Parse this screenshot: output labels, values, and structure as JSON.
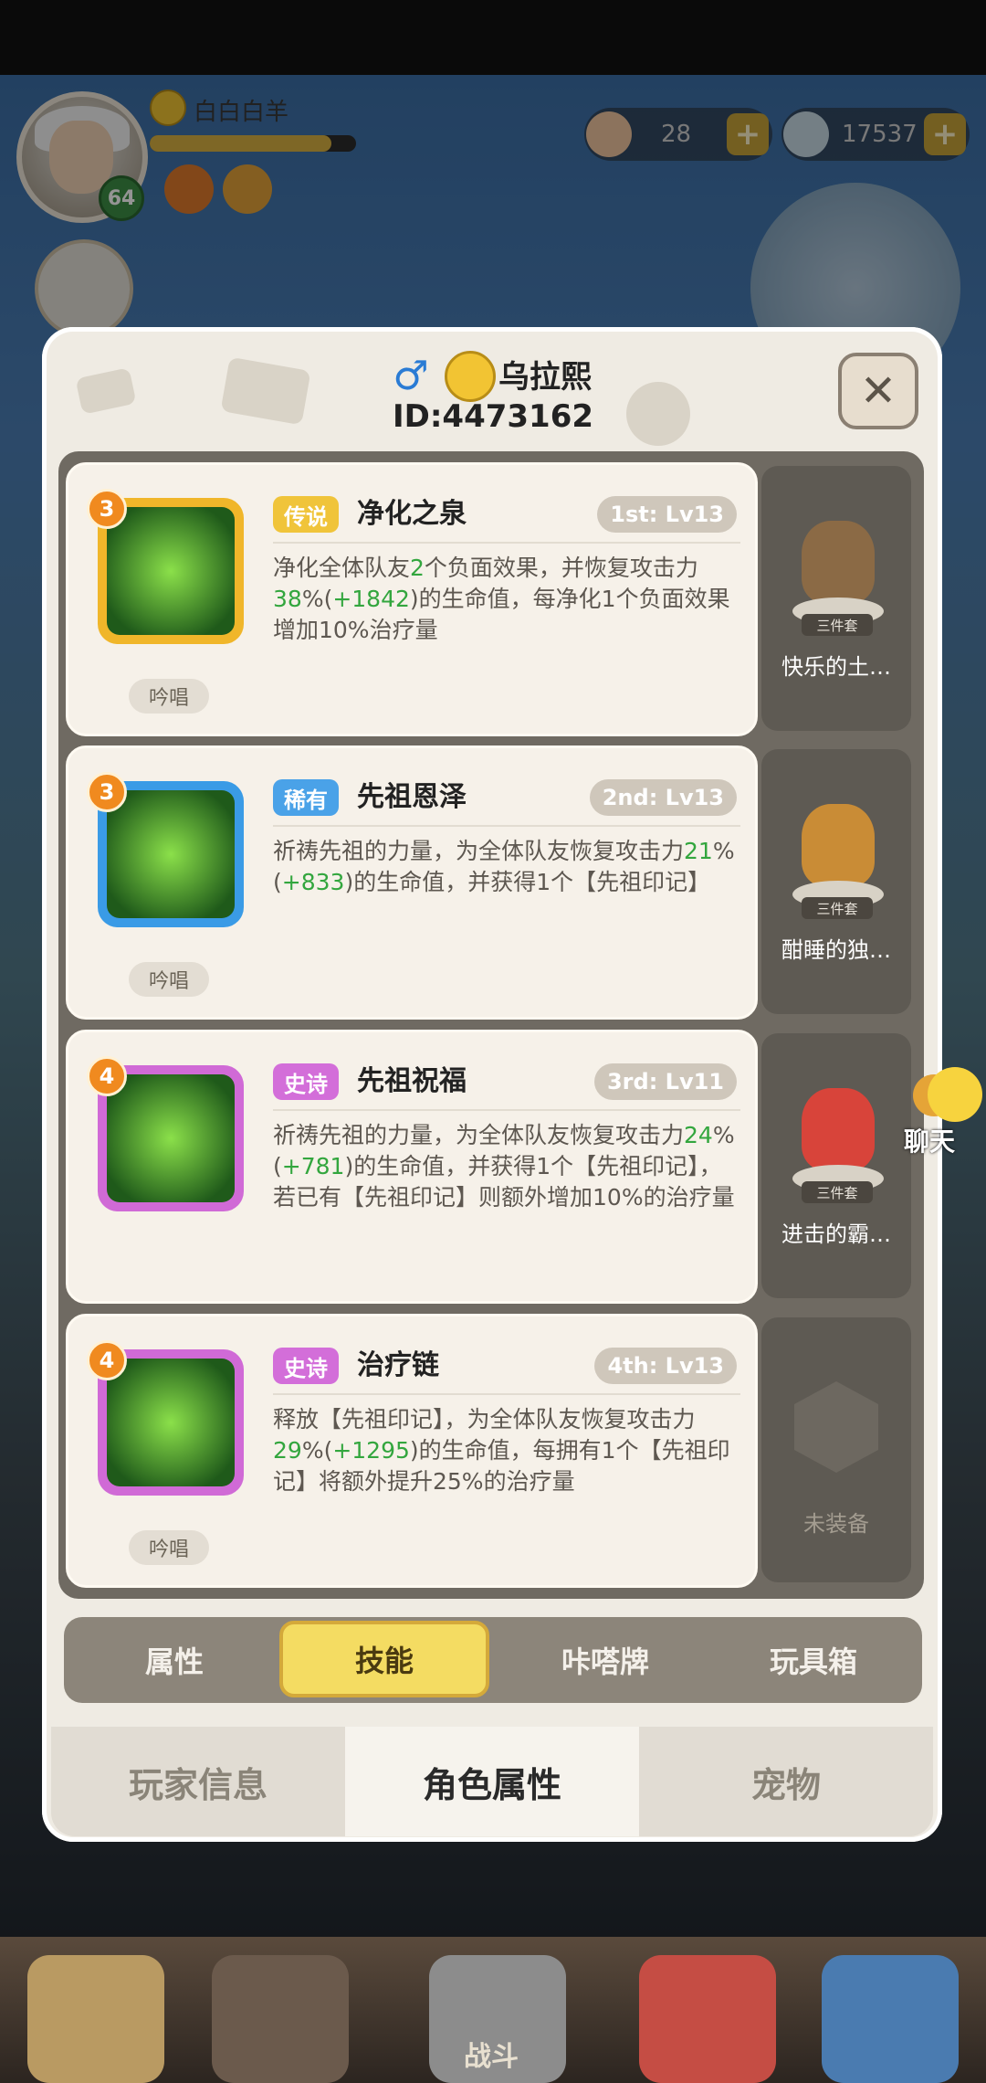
{
  "player": {
    "name": "白白白羊",
    "level": "64",
    "xp_progress": 0.88
  },
  "currency": [
    {
      "icon": "seashell-icon",
      "value": "28"
    },
    {
      "icon": "pearl-icon",
      "value": "17537"
    }
  ],
  "modal": {
    "title_name": "乌拉熙",
    "id_text": "ID:4473162",
    "close_icon": "close-icon"
  },
  "skills": [
    {
      "stars": "3",
      "rarity": "传说",
      "rarity_color": "#f0c43a",
      "name": "净化之泉",
      "level": "1st: Lv13",
      "desc_parts": [
        "净化全体队友",
        "2",
        "个负面效果，并恢复攻击力",
        "38",
        "%(",
        "+1842",
        ")的生命值，每净化1个负面效果增加10%治疗量"
      ],
      "chant": "吟唱",
      "icon_color": "#f0b62a",
      "equip": {
        "name": "快乐的土…",
        "tag": "三件套",
        "color": "#8b6a45"
      }
    },
    {
      "stars": "3",
      "rarity": "稀有",
      "rarity_color": "#4aa2e8",
      "name": "先祖恩泽",
      "level": "2nd: Lv13",
      "desc_parts": [
        "祈祷先祖的力量，为全体队友恢复攻击力",
        "21",
        "%(",
        "+833",
        ")的生命值，并获得1个【先祖印记】",
        "",
        "",
        ""
      ],
      "chant": "吟唱",
      "icon_color": "#3a9be6",
      "equip": {
        "name": "酣睡的独…",
        "tag": "三件套",
        "color": "#c98c36"
      }
    },
    {
      "stars": "4",
      "rarity": "史诗",
      "rarity_color": "#d36ed9",
      "name": "先祖祝福",
      "level": "3rd: Lv11",
      "desc_parts": [
        "祈祷先祖的力量，为全体队友恢复攻击力",
        "24",
        "%(",
        "+781",
        ")的生命值，并获得1个【先祖印记】，若已有【先祖印记】则额外增加10%的治疗量",
        "",
        "",
        ""
      ],
      "chant": "",
      "icon_color": "#d06ad6",
      "equip": {
        "name": "进击的霸…",
        "tag": "三件套",
        "color": "#d8443a"
      }
    },
    {
      "stars": "4",
      "rarity": "史诗",
      "rarity_color": "#d36ed9",
      "name": "治疗链",
      "level": "4th: Lv13",
      "desc_parts": [
        "释放【先祖印记】，为全体队友恢复攻击力",
        "29",
        "%(",
        "+1295",
        ")的生命值，每拥有1个【先祖印记】将额外提升25%的治疗量",
        "",
        "",
        ""
      ],
      "chant": "吟唱",
      "icon_color": "#d06ad6",
      "equip": {
        "name": "未装备",
        "tag": "",
        "color": ""
      }
    }
  ],
  "tabs": [
    "属性",
    "技能",
    "咔嗒牌",
    "玩具箱"
  ],
  "active_tab": "技能",
  "bottom_tabs": [
    "玩家信息",
    "角色属性",
    "宠物"
  ],
  "active_bottom_tab": "角色属性",
  "chat_label": "聊天",
  "nav_label": "战斗"
}
